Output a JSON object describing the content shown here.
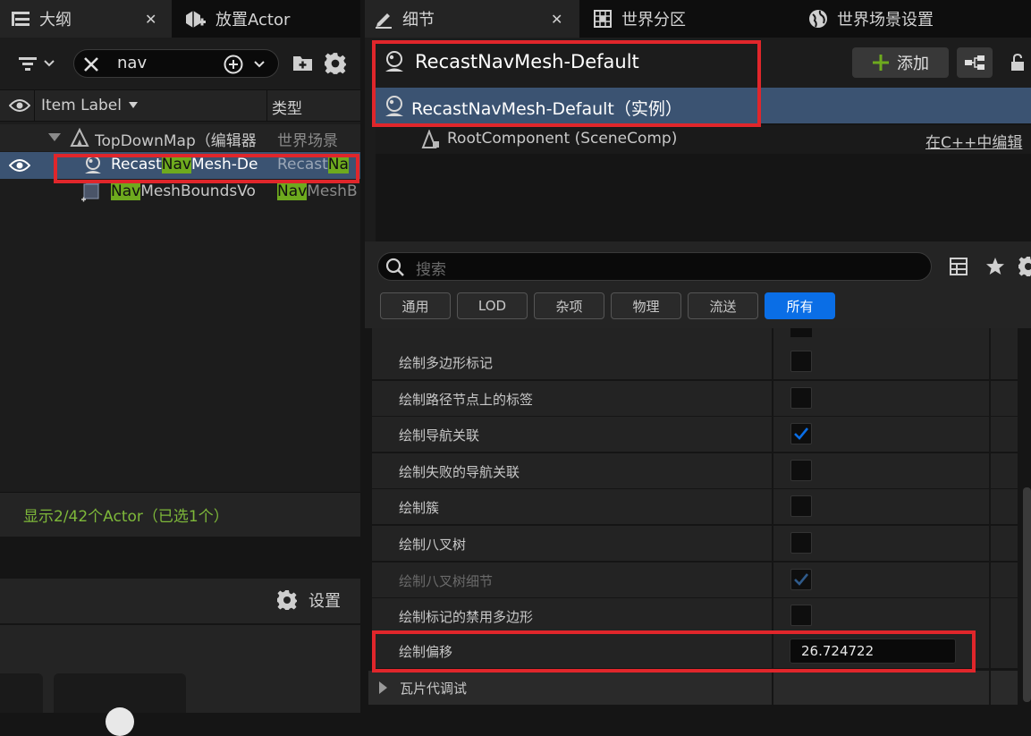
{
  "left_tabs": {
    "outliner": "大纲",
    "close": "✕",
    "place_actor": "放置Actor"
  },
  "outliner": {
    "search_value": "nav",
    "col_label": "Item Label",
    "col_type": "类型",
    "rows": [
      {
        "label": "TopDownMap（编辑器",
        "type": "世界场景"
      },
      {
        "label_pre": "Recast",
        "label_hl": "Nav",
        "label_post": "Mesh-De",
        "type_pre": "Recast",
        "type_hl": "Na"
      },
      {
        "label_hl": "Nav",
        "label_post": "MeshBoundsVo",
        "type_hl": "Nav",
        "type_post": "MeshB"
      }
    ],
    "status": "显示2/42个Actor（已选1个）"
  },
  "bottom_left": {
    "settings": "设置"
  },
  "right_tabs": {
    "details": "细节",
    "close": "✕",
    "world_partition": "世界分区",
    "world_settings": "世界场景设置"
  },
  "details": {
    "actor_name": "RecastNavMesh-Default",
    "add_label": "添加",
    "instance_label": "RecastNavMesh-Default（实例）",
    "root_component": "RootComponent (SceneComp)",
    "edit_in_cpp": "在C++中编辑",
    "search_placeholder": "搜索",
    "filters": [
      "通用",
      "LOD",
      "杂项",
      "物理",
      "流送",
      "所有"
    ],
    "properties": [
      {
        "label": "绘制多边形标记",
        "checked": false
      },
      {
        "label": "绘制路径节点上的标签",
        "checked": false
      },
      {
        "label": "绘制导航关联",
        "checked": true
      },
      {
        "label": "绘制失败的导航关联",
        "checked": false
      },
      {
        "label": "绘制簇",
        "checked": false
      },
      {
        "label": "绘制八叉树",
        "checked": false
      },
      {
        "label": "绘制八叉树细节",
        "checked": true,
        "disabled": true
      },
      {
        "label": "绘制标记的禁用多边形",
        "checked": false
      }
    ],
    "draw_offset_label": "绘制偏移",
    "draw_offset_value": "26.724722",
    "tile_debug_label": "瓦片代调试"
  },
  "colors": {
    "accent_blue": "#0a6ee6",
    "highlight_green": "#6eaa1e",
    "annotation_red": "#e0262b",
    "selected_row": "#3b5372"
  }
}
